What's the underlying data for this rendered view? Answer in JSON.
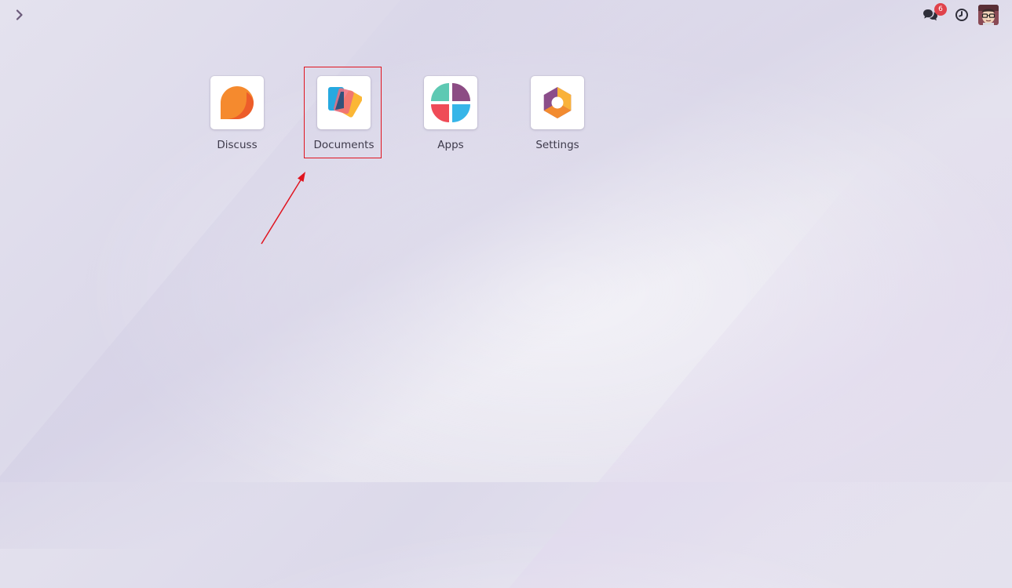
{
  "topbar": {
    "menu_toggle_icon": "chevron-right-icon",
    "messages_icon": "chat-bubbles-icon",
    "messages_count": "6",
    "activity_icon": "clock-icon",
    "avatar_icon": "user-avatar"
  },
  "apps": [
    {
      "label": "Discuss",
      "icon": "discuss-icon"
    },
    {
      "label": "Documents",
      "icon": "documents-icon"
    },
    {
      "label": "Apps",
      "icon": "apps-icon"
    },
    {
      "label": "Settings",
      "icon": "settings-icon"
    }
  ],
  "colors": {
    "badge": "#e0424b",
    "annotation": "#e0141f",
    "discuss_orange": "#f58a2e",
    "documents_blue": "#26a9e0",
    "apps_purple": "#8c4c84",
    "apps_teal": "#5ec9b3",
    "apps_red": "#ef4b57",
    "apps_sky": "#36b5e8",
    "settings_purple": "#8b4d8a",
    "settings_orange": "#f28b30"
  }
}
